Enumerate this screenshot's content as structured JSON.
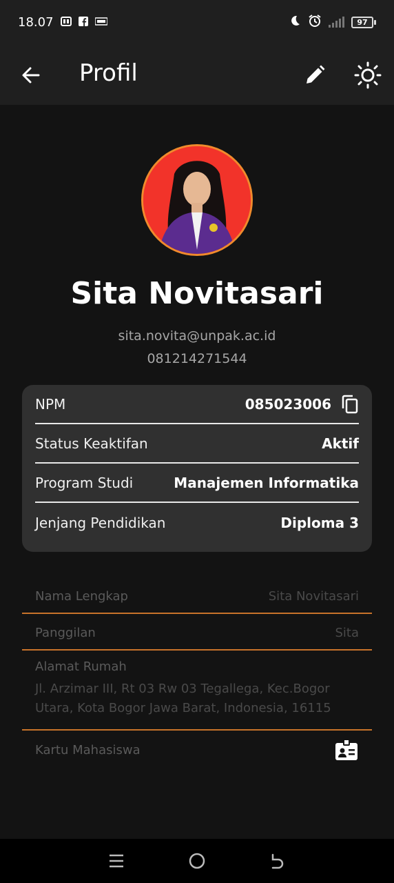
{
  "status_bar": {
    "time": "18.07",
    "notification_icons": [
      "pdf-icon",
      "facebook-icon",
      "klik-icon"
    ],
    "battery": "97"
  },
  "app_bar": {
    "title": "Profil",
    "icons": [
      "back-arrow-icon",
      "pencil-icon",
      "sun-icon"
    ]
  },
  "profile": {
    "name": "Sita Novitasari",
    "email": "sita.novita@unpak.ac.id",
    "phone": "081214271544"
  },
  "info_card": {
    "rows": [
      {
        "label": "NPM",
        "value": "085023006"
      },
      {
        "label": "Status Keaktifan",
        "value": "Aktif"
      },
      {
        "label": "Program Studi",
        "value": "Manajemen Informatika"
      },
      {
        "label": "Jenjang Pendidikan",
        "value": "Diploma 3"
      }
    ]
  },
  "fields": {
    "full_name": {
      "label": "Nama Lengkap",
      "value": "Sita Novitasari"
    },
    "nickname": {
      "label": "Panggilan",
      "value": "Sita"
    },
    "address": {
      "label": "Alamat Rumah",
      "value_line1": "Jl. Arzimar III, Rt 03 Rw 03 Tegallega, Kec.Bogor",
      "value_line2": "Utara, Kota Bogor Jawa Barat, Indonesia, 16115"
    },
    "student_card": {
      "label": "Kartu Mahasiswa"
    }
  },
  "colors": {
    "background": "#131313",
    "app_bar": "#1f1f1f",
    "card": "#303030",
    "accent": "#c8732a",
    "avatar_bg": "#f2332a"
  }
}
